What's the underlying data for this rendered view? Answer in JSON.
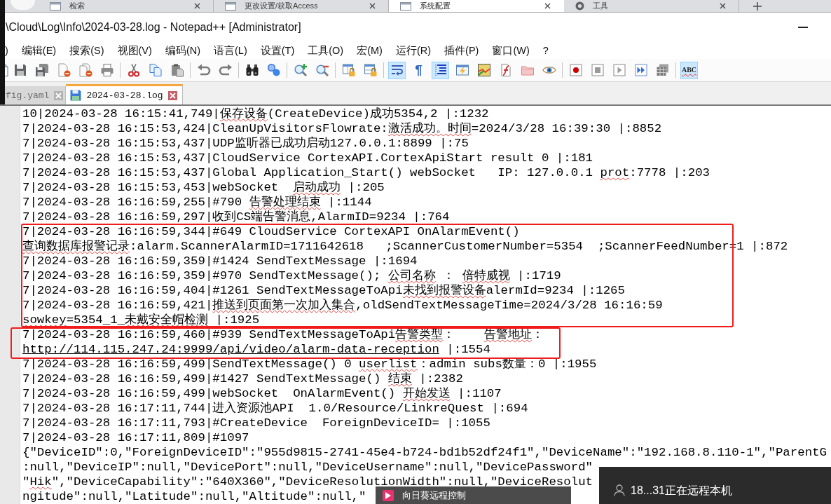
{
  "browser_tabs": [
    {
      "label": "检索",
      "selected": false
    },
    {
      "label": "更改设置/获取Access",
      "selected": false
    },
    {
      "label": "系统配置",
      "selected": true
    },
    {
      "label": "工具",
      "selected": false
    }
  ],
  "window": {
    "title": "\\Cloud\\Log\\Info\\2024-03-28.log - Notepad++ [Administrator]"
  },
  "menu": [
    ")",
    "编辑(E)",
    "搜索(S)",
    "视图(V)",
    "编码(N)",
    "语言(L)",
    "设置(T)",
    "工具(O)",
    "宏(M)",
    "运行(R)",
    "插件(P)",
    "窗口(W)",
    "?"
  ],
  "toolbar": {
    "groups": [
      [
        {
          "on": false
        },
        {
          "on": false
        },
        {
          "on": false
        },
        {
          "on": false
        },
        {
          "on": false
        },
        {
          "on": false
        }
      ],
      [
        {
          "on": false
        },
        {
          "on": false
        },
        {
          "on": false
        }
      ],
      [
        {
          "on": false
        },
        {
          "on": false
        }
      ],
      [
        {
          "on": false
        },
        {
          "on": false
        }
      ],
      [
        {
          "on": false
        },
        {
          "on": false
        }
      ],
      [
        {
          "on": false
        },
        {
          "on": false
        }
      ],
      [
        {
          "on": true
        },
        {
          "on": false,
          "label": "¶"
        },
        {
          "on": true
        },
        {
          "on": false
        },
        {
          "on": false
        },
        {
          "on": false
        },
        {
          "on": false
        },
        {
          "on": false
        }
      ],
      [
        {
          "on": false
        },
        {
          "on": false
        },
        {
          "on": false
        },
        {
          "on": false
        },
        {
          "on": false
        }
      ],
      [
        {
          "on": true,
          "label": "ABC"
        }
      ]
    ]
  },
  "file_tabs": [
    {
      "label": "fig.yaml",
      "selected": false
    },
    {
      "label": "2024-03-28.log",
      "selected": true
    }
  ],
  "editor": {
    "blocks": [
      {
        "framed": false,
        "lines": [
          [
            {
              "kind": "plain",
              "text": "10|2024-03-28 16:15:41,749|"
            },
            {
              "kind": "flagged",
              "text": "保存设备"
            },
            {
              "kind": "plain",
              "text": "(CreateDevice)成功5354,2 |:1232"
            }
          ],
          [
            {
              "kind": "plain",
              "text": "7|2024-03-28 16:15:53,424|CleanUpVisitorsFlowrate:"
            },
            {
              "kind": "flagged",
              "text": "激活成功。时间"
            },
            {
              "kind": "plain",
              "text": "=2024/3/28 16:39:30 |:8852"
            }
          ],
          [
            {
              "kind": "plain",
              "text": "7|2024-03-28 16:15:53,437|UDP监听器已成功启动127.0.0.1:8899 |:75"
            }
          ],
          [
            {
              "kind": "plain",
              "text": "7|2024-03-28 16:15:53,437|CloudService CortexAPI.CortexApiStart result 0 |:181"
            }
          ],
          [
            {
              "kind": "plain",
              "text": "7|2024-03-28 16:15:53,437|Global Application_Start() webSocket   IP: 127.0.0.1 "
            },
            {
              "kind": "flagged",
              "text": "prot"
            },
            {
              "kind": "plain",
              "text": ":7778 |:203"
            }
          ],
          [
            {
              "kind": "plain",
              "text": "7|2024-03-28 16:15:53,453|webSocket  "
            },
            {
              "kind": "flagged",
              "text": "启动成功"
            },
            {
              "kind": "plain",
              "text": " |:205"
            }
          ],
          [
            {
              "kind": "plain",
              "text": "7|2024-03-28 16:16:59,255|#790 "
            },
            {
              "kind": "flagged",
              "text": "告警处理结束"
            },
            {
              "kind": "plain",
              "text": " |:1144"
            }
          ],
          [
            {
              "kind": "plain",
              "text": "7|2024-03-28 16:16:59,297|收到CS端告警消息,AlarmID=9234 |:764"
            }
          ]
        ]
      },
      {
        "framed": true,
        "lines": [
          [
            {
              "kind": "plain",
              "text": "7|2024-03-28 16:16:59,344|#649 CloudService CortexAPI OnAlarmEvent()"
            }
          ],
          [
            {
              "kind": "flagged",
              "text": "查询数据库报警记录"
            },
            {
              "kind": "plain",
              "text": ":alarm.ScannerAlarmID=1711642618   ;ScannerCustomerNumber=5354  ;ScannerFeedNumber=1 |:872"
            }
          ],
          [
            {
              "kind": "plain",
              "text": "7|2024-03-28 16:16:59,359|#1424 SendTextMessage |:1694"
            }
          ],
          [
            {
              "kind": "plain",
              "text": "7|2024-03-28 16:16:59,359|#970 SendTextMessage(); "
            },
            {
              "kind": "flagged",
              "text": "公司名称"
            },
            {
              "kind": "plain",
              "text": " ： "
            },
            {
              "kind": "flagged",
              "text": "倍特威视"
            },
            {
              "kind": "plain",
              "text": " |:1719"
            }
          ],
          [
            {
              "kind": "plain",
              "text": "7|2024-03-28 16:16:59,404|#1261 SendTextMessageToApi"
            },
            {
              "kind": "flagged",
              "text": "未找到报警设备"
            },
            {
              "kind": "plain",
              "text": "alermId=9234 |:1265"
            }
          ],
          [
            {
              "kind": "plain",
              "text": "7|2024-03-28 16:16:59,421|"
            },
            {
              "kind": "flagged",
              "text": "推送到页面第一次加入集合"
            },
            {
              "kind": "plain",
              "text": ",oldSendTextMessageTime=2024/3/28 16:16:59"
            }
          ],
          [
            {
              "kind": "flagged",
              "text": "sowkey"
            },
            {
              "kind": "plain",
              "text": "=5354_1_"
            },
            {
              "kind": "flagged",
              "text": "未戴安全帽检测"
            },
            {
              "kind": "plain",
              "text": " |:1925"
            }
          ]
        ]
      },
      {
        "framed": true,
        "lines": [
          [
            {
              "kind": "plain",
              "text": "7|2024-03-28 16:16:59,460|#939 SendTextMessageToApi"
            },
            {
              "kind": "flagged",
              "text": "告警类型"
            },
            {
              "kind": "plain",
              "text": "：    "
            },
            {
              "kind": "flagged",
              "text": "告警地址"
            },
            {
              "kind": "plain",
              "text": "："
            }
          ],
          [
            {
              "kind": "link",
              "text": "http://114.115.247.24:9999/api/video/alarm-data-reception"
            },
            {
              "kind": "plain",
              "text": " |:1554"
            }
          ]
        ]
      },
      {
        "framed": false,
        "lines": [
          [
            {
              "kind": "plain",
              "text": "7|2024-03-28 16:16:59,499|SendTextMessage() 0 "
            },
            {
              "kind": "flagged",
              "text": "userlist"
            },
            {
              "kind": "plain",
              "text": "：admin subs数量：0 |:1955"
            }
          ],
          [
            {
              "kind": "plain",
              "text": "7|2024-03-28 16:16:59,499|#1427 SendTextMessage() "
            },
            {
              "kind": "flagged",
              "text": "结束"
            },
            {
              "kind": "plain",
              "text": " |:2382"
            }
          ],
          [
            {
              "kind": "plain",
              "text": "7|2024-03-28 16:16:59,499|webSocket  OnAlarmEvent() "
            },
            {
              "kind": "flagged",
              "text": "开始发送"
            },
            {
              "kind": "plain",
              "text": " |:1107"
            }
          ],
          [
            {
              "kind": "plain",
              "text": "7|2024-03-28 16:17:11,744|进入资源池API  1.0/Resource/LinkreQuest |:694"
            }
          ],
          [
            {
              "kind": "plain",
              "text": "7|2024-03-28 16:17:11,793|#CreateDevice  ForeignDeviceID= |:1055"
            }
          ],
          [
            {
              "kind": "plain",
              "text": "7|2024-03-28 16:17:11,809|#1097"
            }
          ],
          [
            {
              "kind": "plain",
              "text": "{\"DeviceID\":0,\"ForeignDeviceID\":\"955d9815-2741-45e4-b724-bd1b52df24f1\",\"DeviceName\":\"192.168.8.110-1\",\"ParentG"
            }
          ],
          [
            {
              "kind": "plain",
              "text": ":null,\"DeviceIP\":null,\"DevicePort\":null,\"DeviceUsername\":null,\"DevicePassword\""
            }
          ],
          [
            {
              "kind": "plain",
              "text": "\""
            },
            {
              "kind": "flagged",
              "text": "Hik"
            },
            {
              "kind": "plain",
              "text": "\",\"DeviceCapability\":\"640X360\",\"DeviceResolutionWidth\":null,\"DeviceResolut"
            }
          ],
          [
            {
              "kind": "plain",
              "text": "ngitude\":null,\"Latitude\":null,\"Altitude\":null,\""
            }
          ]
        ]
      }
    ]
  },
  "remote_notice": {
    "text": "18...31正在远程本机"
  },
  "taskbar": {
    "label": "向日葵远程控制"
  }
}
